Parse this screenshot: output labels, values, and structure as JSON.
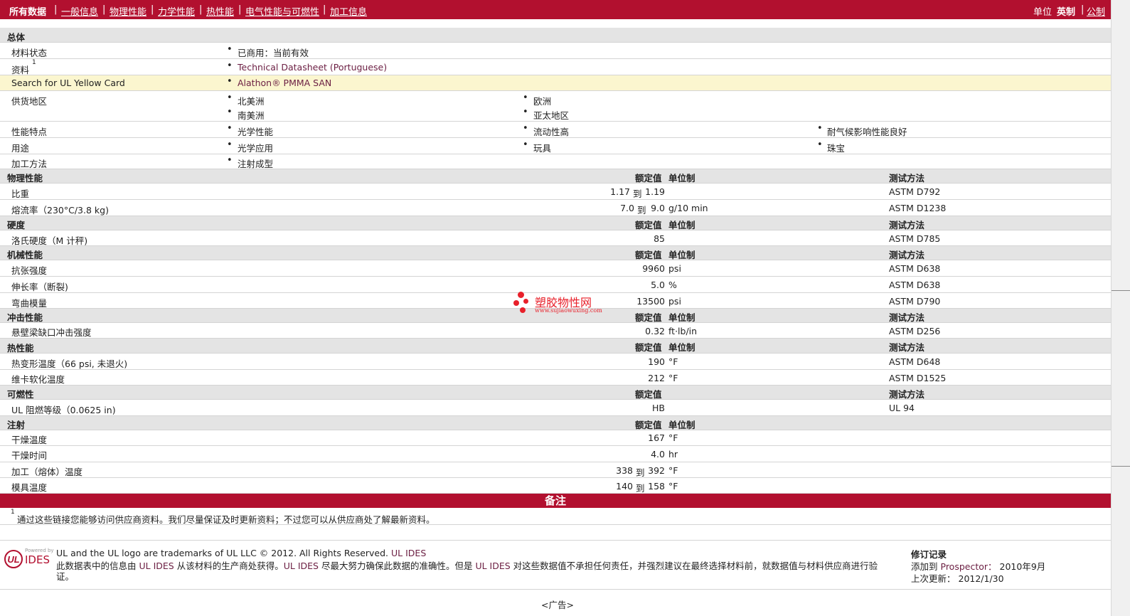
{
  "nav": {
    "all_data": "所有数据",
    "tabs": [
      "一般信息",
      "物理性能",
      "力学性能",
      "热性能",
      "电气性能与可燃性",
      "加工信息"
    ],
    "unit_label": "单位",
    "unit_english": "英制",
    "unit_metric": "公制"
  },
  "general": {
    "title": "总体",
    "material_status_label": "材料状态",
    "material_status_value": "已商用：当前有效",
    "literature_label": "资料",
    "literature_sup": "1",
    "literature_value": "Technical Datasheet (Portuguese)",
    "ul_label": "Search for UL Yellow Card",
    "ul_value": "Alathon® PMMA SAN",
    "supply_label": "供货地区",
    "supply": [
      "北美洲",
      "欧洲",
      "南美洲",
      "亚太地区"
    ],
    "features_label": "性能特点",
    "features": [
      "光学性能",
      "流动性高",
      "耐气候影响性能良好"
    ],
    "uses_label": "用途",
    "uses": [
      "光学应用",
      "玩具",
      "珠宝"
    ],
    "processing_label": "加工方法",
    "processing": [
      "注射成型"
    ]
  },
  "headers": {
    "nominal": "额定值",
    "unit": "单位制",
    "method": "测试方法"
  },
  "sections": {
    "physical": "物理性能",
    "hardness": "硬度",
    "mechanical": "机械性能",
    "impact": "冲击性能",
    "thermal": "热性能",
    "flammability": "可燃性",
    "injection": "注射"
  },
  "rows": {
    "sg": {
      "label": "比重",
      "v1": "1.17",
      "to": "到",
      "v2": "1.19",
      "unit": "",
      "method": "ASTM D792"
    },
    "mfr": {
      "label": "熔流率（230°C/3.8 kg)",
      "v1": "7.0",
      "to": "到",
      "v2": "9.0",
      "unit": "g/10 min",
      "method": "ASTM D1238"
    },
    "rockwell": {
      "label": "洛氏硬度（M 计秤)",
      "v": "85",
      "unit": "",
      "method": "ASTM D785"
    },
    "tensile": {
      "label": "抗张强度",
      "v": "9960",
      "unit": "psi",
      "method": "ASTM D638"
    },
    "elong": {
      "label": "伸长率（断裂)",
      "v": "5.0",
      "unit": "%",
      "method": "ASTM D638"
    },
    "flex": {
      "label": "弯曲模量",
      "v": "13500",
      "unit": "psi",
      "method": "ASTM D790"
    },
    "izod": {
      "label": "悬壁梁缺口冲击强度",
      "v": "0.32",
      "unit": "ft·lb/in",
      "method": "ASTM D256"
    },
    "hdt": {
      "label": "热变形温度（66 psi, 未退火)",
      "v": "190",
      "unit": "°F",
      "method": "ASTM D648"
    },
    "vicat": {
      "label": "维卡软化温度",
      "v": "212",
      "unit": "°F",
      "method": "ASTM D1525"
    },
    "ul94": {
      "label": "UL 阻燃等级（0.0625 in)",
      "v": "HB",
      "unit": "",
      "method": "UL 94"
    },
    "dry_temp": {
      "label": "干燥温度",
      "v": "167",
      "unit": "°F"
    },
    "dry_time": {
      "label": "干燥时间",
      "v": "4.0",
      "unit": "hr"
    },
    "melt_temp": {
      "label": "加工（熔体）温度",
      "v1": "338",
      "to": "到",
      "v2": "392",
      "unit": "°F"
    },
    "mold_temp": {
      "label": "模具温度",
      "v1": "140",
      "to": "到",
      "v2": "158",
      "unit": "°F"
    }
  },
  "watermark": {
    "text": "塑胶物性网",
    "url": "www.sujiaowuxing.com"
  },
  "notes": {
    "title": "备注",
    "sup": "1",
    "text": "通过这些链接您能够访问供应商资料。我们尽量保证及时更新资料；不过您可以从供应商处了解最新资料。"
  },
  "footer": {
    "powered": "Powered by",
    "ides": "IDES",
    "line1_a": "UL and the UL logo are trademarks of UL LLC © 2012. All Rights Reserved.",
    "line1_b": "UL IDES",
    "line2_a": "此数据表中的信息由",
    "line2_b": "UL IDES",
    "line2_c": "从该材料的生产商处获得。",
    "line2_d": "UL IDES",
    "line2_e": "尽最大努力确保此数据的准确性。但是",
    "line2_f": "UL IDES",
    "line2_g": "对这些数据值不承担任何责任，并强烈建议在最终选择材料前，就数据值与材料供应商进行验",
    "line3": "证。",
    "rev_title": "修订记录",
    "added_label": "添加到",
    "added_link": "Prospector：",
    "added_date": "2010年9月",
    "updated_label": "上次更新：",
    "updated_date": "2012/1/30",
    "ad": "<广告>"
  },
  "colors": {
    "brand": "#b2102f",
    "section_bg": "#e4e4e4",
    "highlight": "#fbf6cf",
    "link": "#6b1e42"
  }
}
